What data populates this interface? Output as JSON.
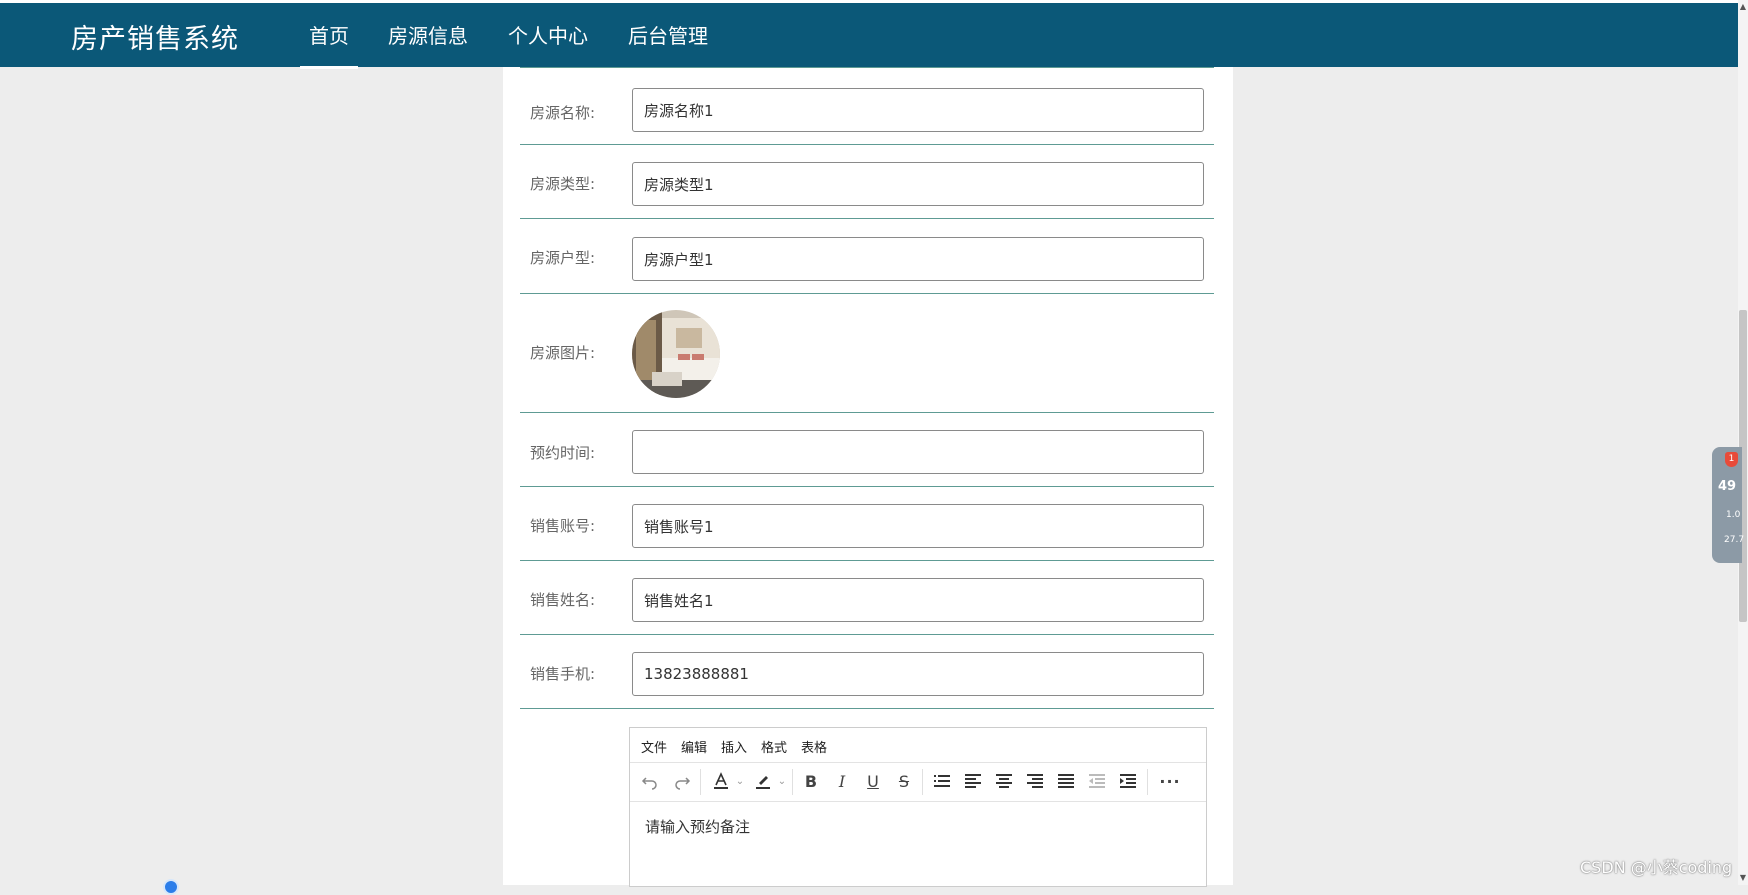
{
  "app": {
    "brand": "房产销售系统"
  },
  "nav": {
    "items": [
      {
        "label": "首页",
        "active": true
      },
      {
        "label": "房源信息",
        "active": false
      },
      {
        "label": "个人中心",
        "active": false
      },
      {
        "label": "后台管理",
        "active": false
      }
    ]
  },
  "form": {
    "fields": [
      {
        "label": "房源名称:",
        "value": "房源名称1"
      },
      {
        "label": "房源类型:",
        "value": "房源类型1"
      },
      {
        "label": "房源户型:",
        "value": "房源户型1"
      },
      {
        "label": "房源图片:",
        "value": ""
      },
      {
        "label": "预约时间:",
        "value": ""
      },
      {
        "label": "销售账号:",
        "value": "销售账号1"
      },
      {
        "label": "销售姓名:",
        "value": "销售姓名1"
      },
      {
        "label": "销售手机:",
        "value": "13823888881"
      }
    ]
  },
  "editor": {
    "menu": [
      "文件",
      "编辑",
      "插入",
      "格式",
      "表格"
    ],
    "placeholder": "请输入预约备注",
    "toolbar_icons": [
      "undo-icon",
      "redo-icon",
      "text-color-icon",
      "highlight-color-icon",
      "bold-icon",
      "italic-icon",
      "underline-icon",
      "strikethrough-icon",
      "list-icon",
      "align-left-icon",
      "align-center-icon",
      "align-right-icon",
      "align-justify-icon",
      "outdent-icon",
      "indent-icon",
      "more-icon"
    ]
  },
  "widget": {
    "badge": "1",
    "value": "49",
    "stat1": "1.0",
    "stat2": "27.7"
  },
  "watermark": "CSDN @小蔡coding",
  "colors": {
    "navbar": "#0b5878",
    "divider": "#5e9b94",
    "background": "#ededed"
  }
}
